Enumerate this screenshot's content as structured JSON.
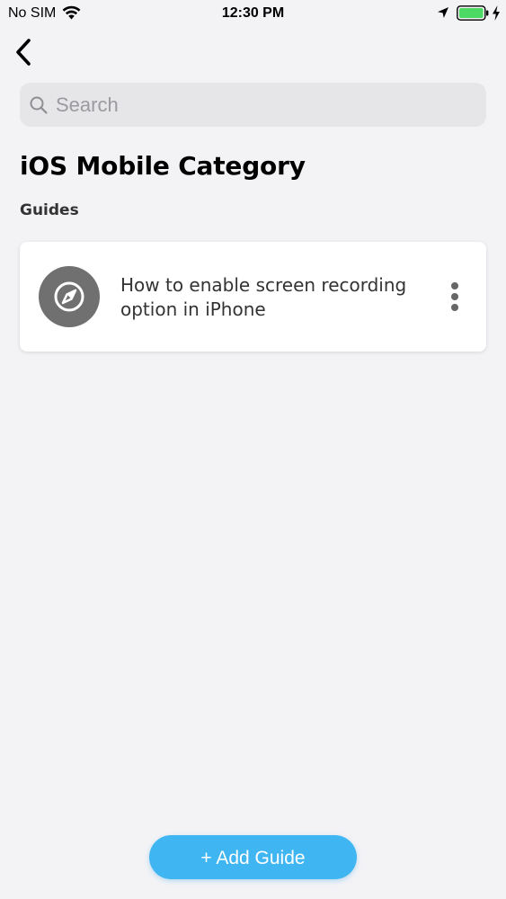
{
  "status_bar": {
    "carrier": "No SIM",
    "time": "12:30 PM",
    "battery_color": "#4cd964"
  },
  "search": {
    "placeholder": "Search",
    "value": ""
  },
  "page": {
    "title": "iOS Mobile Category",
    "section_title": "Guides"
  },
  "guides": [
    {
      "title": "How to enable screen recording option in iPhone",
      "icon": "compass-icon"
    }
  ],
  "actions": {
    "add_guide_label": "+ Add Guide",
    "accent_color": "#3fb5f2"
  }
}
